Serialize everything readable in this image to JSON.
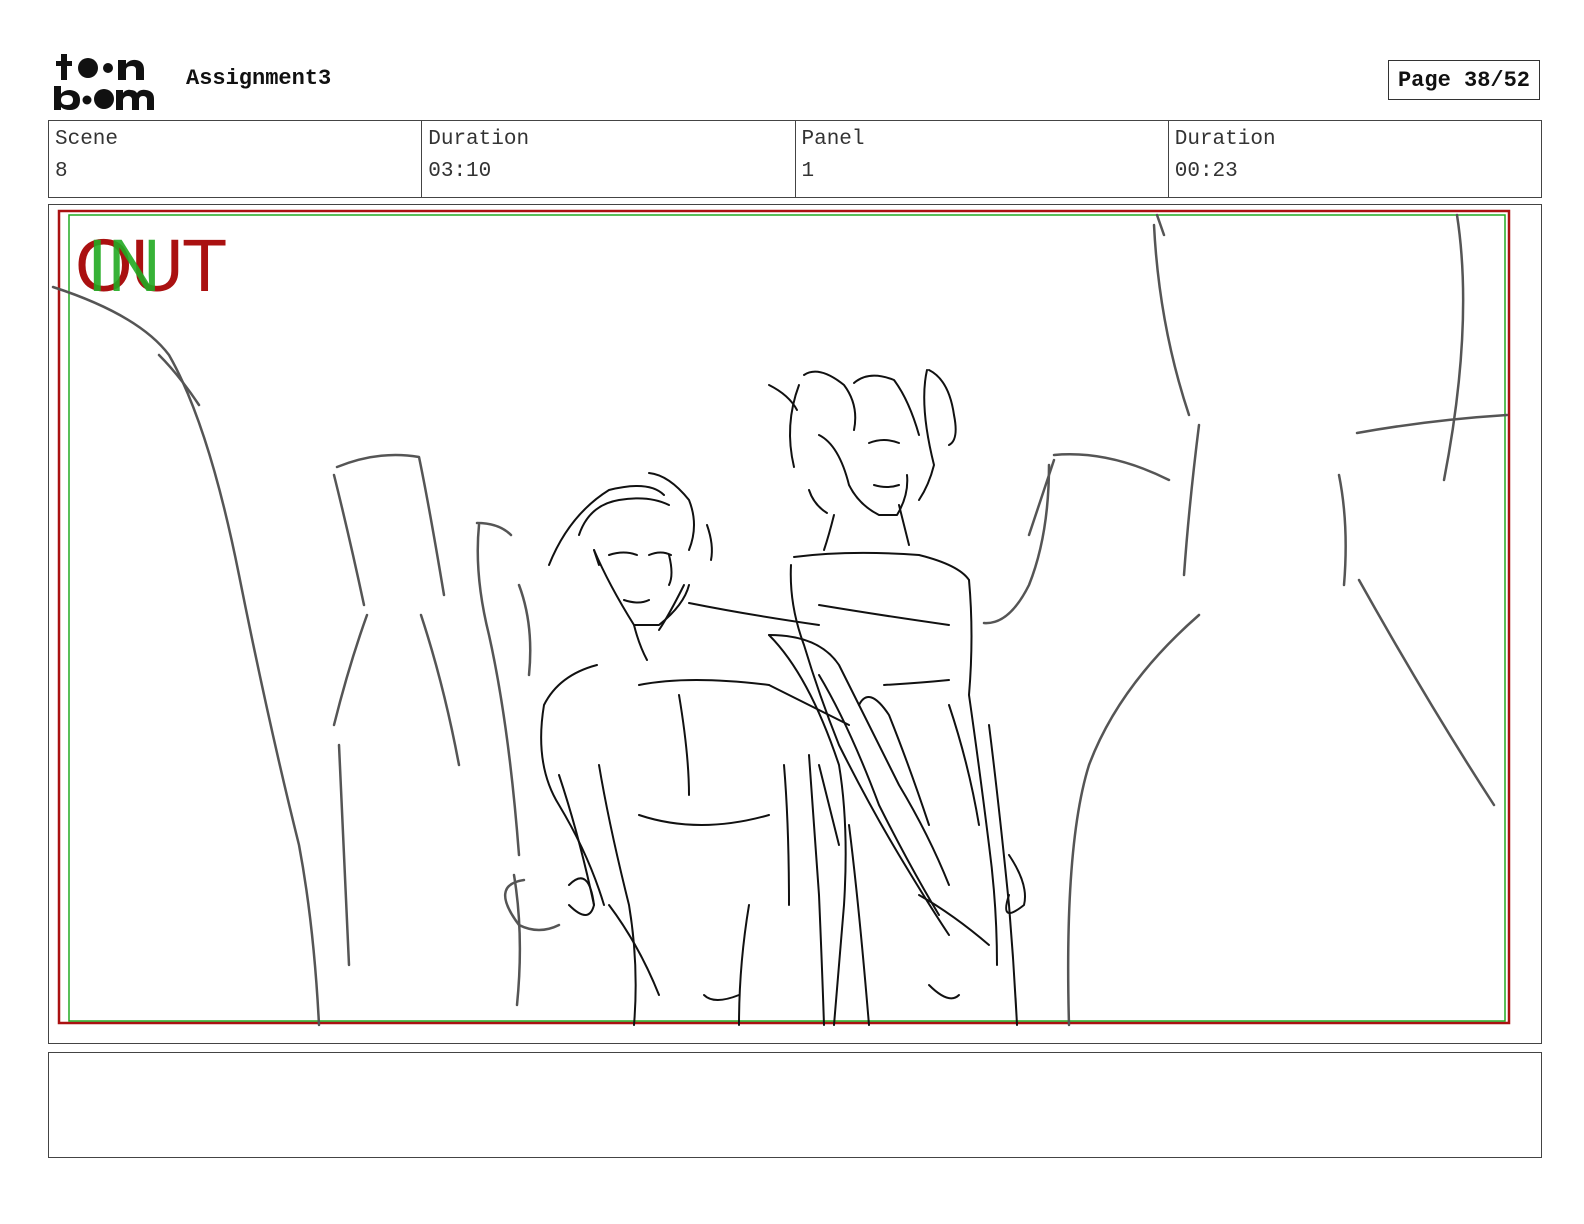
{
  "header": {
    "logo": {
      "icon": "toonboom-logo-icon",
      "text_line1": "toon",
      "text_line2": "boom"
    },
    "project_title": "Assignment3",
    "page_indicator": "Page 38/52"
  },
  "info": {
    "scene_label": "Scene",
    "scene_value": "8",
    "scene_duration_label": "Duration",
    "scene_duration_value": "03:10",
    "panel_label": "Panel",
    "panel_value": "1",
    "panel_duration_label": "Duration",
    "panel_duration_value": "00:23"
  },
  "panel": {
    "marker_out": "OUT",
    "marker_in": "IN",
    "out_frame_color": "#aa1111",
    "in_frame_color": "#22aa22"
  },
  "notes": {
    "text": ""
  }
}
